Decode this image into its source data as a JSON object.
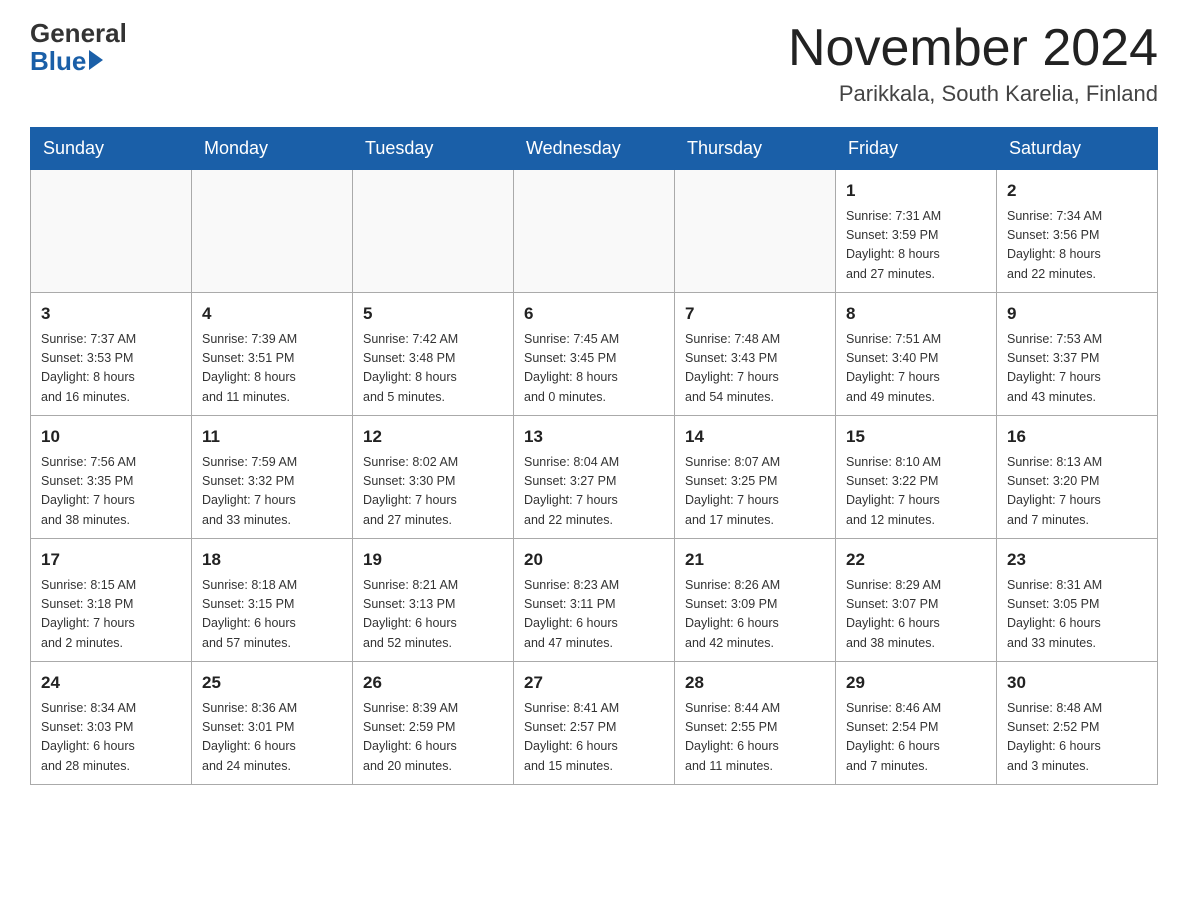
{
  "logo": {
    "general": "General",
    "blue": "Blue"
  },
  "title": "November 2024",
  "location": "Parikkala, South Karelia, Finland",
  "weekdays": [
    "Sunday",
    "Monday",
    "Tuesday",
    "Wednesday",
    "Thursday",
    "Friday",
    "Saturday"
  ],
  "weeks": [
    [
      {
        "day": "",
        "info": ""
      },
      {
        "day": "",
        "info": ""
      },
      {
        "day": "",
        "info": ""
      },
      {
        "day": "",
        "info": ""
      },
      {
        "day": "",
        "info": ""
      },
      {
        "day": "1",
        "info": "Sunrise: 7:31 AM\nSunset: 3:59 PM\nDaylight: 8 hours\nand 27 minutes."
      },
      {
        "day": "2",
        "info": "Sunrise: 7:34 AM\nSunset: 3:56 PM\nDaylight: 8 hours\nand 22 minutes."
      }
    ],
    [
      {
        "day": "3",
        "info": "Sunrise: 7:37 AM\nSunset: 3:53 PM\nDaylight: 8 hours\nand 16 minutes."
      },
      {
        "day": "4",
        "info": "Sunrise: 7:39 AM\nSunset: 3:51 PM\nDaylight: 8 hours\nand 11 minutes."
      },
      {
        "day": "5",
        "info": "Sunrise: 7:42 AM\nSunset: 3:48 PM\nDaylight: 8 hours\nand 5 minutes."
      },
      {
        "day": "6",
        "info": "Sunrise: 7:45 AM\nSunset: 3:45 PM\nDaylight: 8 hours\nand 0 minutes."
      },
      {
        "day": "7",
        "info": "Sunrise: 7:48 AM\nSunset: 3:43 PM\nDaylight: 7 hours\nand 54 minutes."
      },
      {
        "day": "8",
        "info": "Sunrise: 7:51 AM\nSunset: 3:40 PM\nDaylight: 7 hours\nand 49 minutes."
      },
      {
        "day": "9",
        "info": "Sunrise: 7:53 AM\nSunset: 3:37 PM\nDaylight: 7 hours\nand 43 minutes."
      }
    ],
    [
      {
        "day": "10",
        "info": "Sunrise: 7:56 AM\nSunset: 3:35 PM\nDaylight: 7 hours\nand 38 minutes."
      },
      {
        "day": "11",
        "info": "Sunrise: 7:59 AM\nSunset: 3:32 PM\nDaylight: 7 hours\nand 33 minutes."
      },
      {
        "day": "12",
        "info": "Sunrise: 8:02 AM\nSunset: 3:30 PM\nDaylight: 7 hours\nand 27 minutes."
      },
      {
        "day": "13",
        "info": "Sunrise: 8:04 AM\nSunset: 3:27 PM\nDaylight: 7 hours\nand 22 minutes."
      },
      {
        "day": "14",
        "info": "Sunrise: 8:07 AM\nSunset: 3:25 PM\nDaylight: 7 hours\nand 17 minutes."
      },
      {
        "day": "15",
        "info": "Sunrise: 8:10 AM\nSunset: 3:22 PM\nDaylight: 7 hours\nand 12 minutes."
      },
      {
        "day": "16",
        "info": "Sunrise: 8:13 AM\nSunset: 3:20 PM\nDaylight: 7 hours\nand 7 minutes."
      }
    ],
    [
      {
        "day": "17",
        "info": "Sunrise: 8:15 AM\nSunset: 3:18 PM\nDaylight: 7 hours\nand 2 minutes."
      },
      {
        "day": "18",
        "info": "Sunrise: 8:18 AM\nSunset: 3:15 PM\nDaylight: 6 hours\nand 57 minutes."
      },
      {
        "day": "19",
        "info": "Sunrise: 8:21 AM\nSunset: 3:13 PM\nDaylight: 6 hours\nand 52 minutes."
      },
      {
        "day": "20",
        "info": "Sunrise: 8:23 AM\nSunset: 3:11 PM\nDaylight: 6 hours\nand 47 minutes."
      },
      {
        "day": "21",
        "info": "Sunrise: 8:26 AM\nSunset: 3:09 PM\nDaylight: 6 hours\nand 42 minutes."
      },
      {
        "day": "22",
        "info": "Sunrise: 8:29 AM\nSunset: 3:07 PM\nDaylight: 6 hours\nand 38 minutes."
      },
      {
        "day": "23",
        "info": "Sunrise: 8:31 AM\nSunset: 3:05 PM\nDaylight: 6 hours\nand 33 minutes."
      }
    ],
    [
      {
        "day": "24",
        "info": "Sunrise: 8:34 AM\nSunset: 3:03 PM\nDaylight: 6 hours\nand 28 minutes."
      },
      {
        "day": "25",
        "info": "Sunrise: 8:36 AM\nSunset: 3:01 PM\nDaylight: 6 hours\nand 24 minutes."
      },
      {
        "day": "26",
        "info": "Sunrise: 8:39 AM\nSunset: 2:59 PM\nDaylight: 6 hours\nand 20 minutes."
      },
      {
        "day": "27",
        "info": "Sunrise: 8:41 AM\nSunset: 2:57 PM\nDaylight: 6 hours\nand 15 minutes."
      },
      {
        "day": "28",
        "info": "Sunrise: 8:44 AM\nSunset: 2:55 PM\nDaylight: 6 hours\nand 11 minutes."
      },
      {
        "day": "29",
        "info": "Sunrise: 8:46 AM\nSunset: 2:54 PM\nDaylight: 6 hours\nand 7 minutes."
      },
      {
        "day": "30",
        "info": "Sunrise: 8:48 AM\nSunset: 2:52 PM\nDaylight: 6 hours\nand 3 minutes."
      }
    ]
  ]
}
